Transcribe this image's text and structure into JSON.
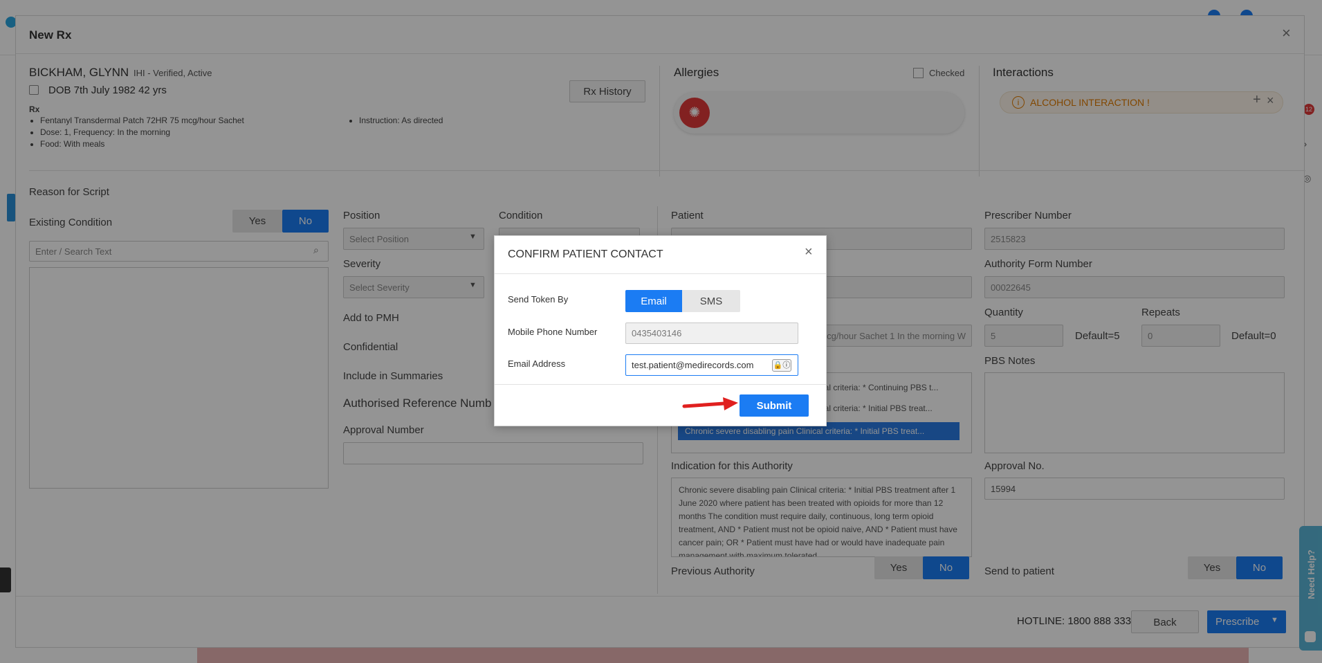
{
  "modal": {
    "title": "New Rx",
    "close": "×"
  },
  "patient": {
    "name": "BICKHAM, GLYNN",
    "ihi": "IHI - Verified, Active",
    "dob": "DOB 7th July 1982 42 yrs",
    "rx_label": "Rx",
    "rx_items": [
      "Fentanyl Transdermal Patch 72HR 75 mcg/hour Sachet",
      "Dose: 1, Frequency: In the morning",
      "Food: With meals"
    ],
    "instruction": "Instruction: As directed",
    "rx_history_button": "Rx History"
  },
  "allergies": {
    "title": "Allergies",
    "checked_label": "Checked"
  },
  "interactions": {
    "title": "Interactions",
    "alcohol": "ALCOHOL INTERACTION !"
  },
  "reason": {
    "title": "Reason for Script",
    "existing_condition": "Existing Condition",
    "yes": "Yes",
    "no": "No",
    "search_placeholder": "Enter / Search Text"
  },
  "middle": {
    "position": "Position",
    "position_placeholder": "Select Position",
    "condition": "Condition",
    "severity": "Severity",
    "severity_placeholder": "Select Severity",
    "add_to_pmh": "Add to PMH",
    "confidential": "Confidential",
    "include_in_summaries": "Include in Summaries",
    "authorised_reference": "Authorised Reference Numb",
    "approval_number": "Approval Number"
  },
  "authority": {
    "patient": "Patient",
    "snippet": "mcg/hour Sachet 1 In the morning W",
    "list_items": [
      "ical criteria: * Continuing PBS t...",
      "ical criteria: * Initial PBS treat...",
      "Chronic severe disabling pain Clinical criteria: * Initial PBS treat..."
    ],
    "indication_title": "Indication for this Authority",
    "indication_text": "Chronic severe disabling pain Clinical criteria: * Initial PBS treatment after 1 June 2020 where patient has been treated with opioids for more than 12 months The condition must require daily, continuous, long term opioid treatment, AND * Patient must not be opioid naive, AND * Patient must have cancer pain; OR * Patient must have had or would have inadequate pain management with maximum tolerated",
    "previous_authority": "Previous Authority",
    "yes": "Yes",
    "no": "No"
  },
  "prescriber": {
    "prescriber_number_label": "Prescriber Number",
    "prescriber_number": "2515823",
    "authority_form_label": "Authority Form Number",
    "authority_form": "00022645",
    "quantity_label": "Quantity",
    "quantity": "5",
    "quantity_default": "Default=5",
    "repeats_label": "Repeats",
    "repeats": "0",
    "repeats_default": "Default=0",
    "pbs_notes_label": "PBS Notes",
    "approval_no_label": "Approval No.",
    "approval_no": "15994",
    "send_to_patient": "Send to patient",
    "yes": "Yes",
    "no": "No"
  },
  "footer": {
    "hotline": "HOTLINE: 1800 888 333",
    "back": "Back",
    "prescribe": "Prescribe"
  },
  "side": {
    "badge": "12",
    "help": "Need Help?"
  },
  "dialog": {
    "title": "CONFIRM PATIENT CONTACT",
    "send_token_label": "Send Token By",
    "email_option": "Email",
    "sms_option": "SMS",
    "mobile_label": "Mobile Phone Number",
    "mobile_value": "0435403146",
    "email_label": "Email Address",
    "email_value": "test.patient@medirecords.com",
    "submit": "Submit"
  },
  "colors": {
    "primary": "#1b7cf3",
    "alert": "#e07b00",
    "allergy": "#e03a3a",
    "arrow": "#e0201f"
  }
}
